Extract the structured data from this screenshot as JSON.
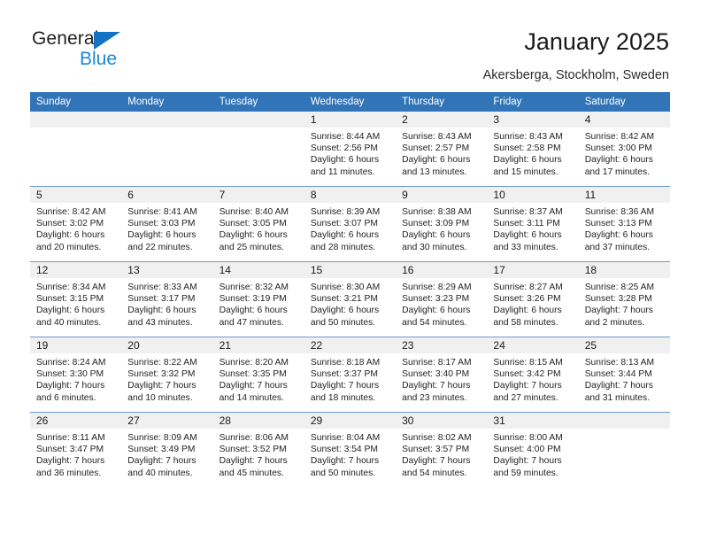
{
  "brand": {
    "name_part1": "General",
    "name_part2": "Blue",
    "triangle_icon": "blue-triangle-icon",
    "color_dark": "#231f20",
    "color_blue": "#1a87d8"
  },
  "header": {
    "title": "January 2025",
    "location": "Akersberga, Stockholm, Sweden"
  },
  "calendar": {
    "accent_color": "#3274b8",
    "daynum_band_color": "#f0f0f0",
    "weekday_headers": [
      "Sunday",
      "Monday",
      "Tuesday",
      "Wednesday",
      "Thursday",
      "Friday",
      "Saturday"
    ],
    "weeks": [
      [
        {
          "day": "",
          "blank": true
        },
        {
          "day": "",
          "blank": true
        },
        {
          "day": "",
          "blank": true
        },
        {
          "day": "1",
          "sunrise": "Sunrise: 8:44 AM",
          "sunset": "Sunset: 2:56 PM",
          "daylight_line1": "Daylight: 6 hours",
          "daylight_line2": "and 11 minutes."
        },
        {
          "day": "2",
          "sunrise": "Sunrise: 8:43 AM",
          "sunset": "Sunset: 2:57 PM",
          "daylight_line1": "Daylight: 6 hours",
          "daylight_line2": "and 13 minutes."
        },
        {
          "day": "3",
          "sunrise": "Sunrise: 8:43 AM",
          "sunset": "Sunset: 2:58 PM",
          "daylight_line1": "Daylight: 6 hours",
          "daylight_line2": "and 15 minutes."
        },
        {
          "day": "4",
          "sunrise": "Sunrise: 8:42 AM",
          "sunset": "Sunset: 3:00 PM",
          "daylight_line1": "Daylight: 6 hours",
          "daylight_line2": "and 17 minutes."
        }
      ],
      [
        {
          "day": "5",
          "sunrise": "Sunrise: 8:42 AM",
          "sunset": "Sunset: 3:02 PM",
          "daylight_line1": "Daylight: 6 hours",
          "daylight_line2": "and 20 minutes."
        },
        {
          "day": "6",
          "sunrise": "Sunrise: 8:41 AM",
          "sunset": "Sunset: 3:03 PM",
          "daylight_line1": "Daylight: 6 hours",
          "daylight_line2": "and 22 minutes."
        },
        {
          "day": "7",
          "sunrise": "Sunrise: 8:40 AM",
          "sunset": "Sunset: 3:05 PM",
          "daylight_line1": "Daylight: 6 hours",
          "daylight_line2": "and 25 minutes."
        },
        {
          "day": "8",
          "sunrise": "Sunrise: 8:39 AM",
          "sunset": "Sunset: 3:07 PM",
          "daylight_line1": "Daylight: 6 hours",
          "daylight_line2": "and 28 minutes."
        },
        {
          "day": "9",
          "sunrise": "Sunrise: 8:38 AM",
          "sunset": "Sunset: 3:09 PM",
          "daylight_line1": "Daylight: 6 hours",
          "daylight_line2": "and 30 minutes."
        },
        {
          "day": "10",
          "sunrise": "Sunrise: 8:37 AM",
          "sunset": "Sunset: 3:11 PM",
          "daylight_line1": "Daylight: 6 hours",
          "daylight_line2": "and 33 minutes."
        },
        {
          "day": "11",
          "sunrise": "Sunrise: 8:36 AM",
          "sunset": "Sunset: 3:13 PM",
          "daylight_line1": "Daylight: 6 hours",
          "daylight_line2": "and 37 minutes."
        }
      ],
      [
        {
          "day": "12",
          "sunrise": "Sunrise: 8:34 AM",
          "sunset": "Sunset: 3:15 PM",
          "daylight_line1": "Daylight: 6 hours",
          "daylight_line2": "and 40 minutes."
        },
        {
          "day": "13",
          "sunrise": "Sunrise: 8:33 AM",
          "sunset": "Sunset: 3:17 PM",
          "daylight_line1": "Daylight: 6 hours",
          "daylight_line2": "and 43 minutes."
        },
        {
          "day": "14",
          "sunrise": "Sunrise: 8:32 AM",
          "sunset": "Sunset: 3:19 PM",
          "daylight_line1": "Daylight: 6 hours",
          "daylight_line2": "and 47 minutes."
        },
        {
          "day": "15",
          "sunrise": "Sunrise: 8:30 AM",
          "sunset": "Sunset: 3:21 PM",
          "daylight_line1": "Daylight: 6 hours",
          "daylight_line2": "and 50 minutes."
        },
        {
          "day": "16",
          "sunrise": "Sunrise: 8:29 AM",
          "sunset": "Sunset: 3:23 PM",
          "daylight_line1": "Daylight: 6 hours",
          "daylight_line2": "and 54 minutes."
        },
        {
          "day": "17",
          "sunrise": "Sunrise: 8:27 AM",
          "sunset": "Sunset: 3:26 PM",
          "daylight_line1": "Daylight: 6 hours",
          "daylight_line2": "and 58 minutes."
        },
        {
          "day": "18",
          "sunrise": "Sunrise: 8:25 AM",
          "sunset": "Sunset: 3:28 PM",
          "daylight_line1": "Daylight: 7 hours",
          "daylight_line2": "and 2 minutes."
        }
      ],
      [
        {
          "day": "19",
          "sunrise": "Sunrise: 8:24 AM",
          "sunset": "Sunset: 3:30 PM",
          "daylight_line1": "Daylight: 7 hours",
          "daylight_line2": "and 6 minutes."
        },
        {
          "day": "20",
          "sunrise": "Sunrise: 8:22 AM",
          "sunset": "Sunset: 3:32 PM",
          "daylight_line1": "Daylight: 7 hours",
          "daylight_line2": "and 10 minutes."
        },
        {
          "day": "21",
          "sunrise": "Sunrise: 8:20 AM",
          "sunset": "Sunset: 3:35 PM",
          "daylight_line1": "Daylight: 7 hours",
          "daylight_line2": "and 14 minutes."
        },
        {
          "day": "22",
          "sunrise": "Sunrise: 8:18 AM",
          "sunset": "Sunset: 3:37 PM",
          "daylight_line1": "Daylight: 7 hours",
          "daylight_line2": "and 18 minutes."
        },
        {
          "day": "23",
          "sunrise": "Sunrise: 8:17 AM",
          "sunset": "Sunset: 3:40 PM",
          "daylight_line1": "Daylight: 7 hours",
          "daylight_line2": "and 23 minutes."
        },
        {
          "day": "24",
          "sunrise": "Sunrise: 8:15 AM",
          "sunset": "Sunset: 3:42 PM",
          "daylight_line1": "Daylight: 7 hours",
          "daylight_line2": "and 27 minutes."
        },
        {
          "day": "25",
          "sunrise": "Sunrise: 8:13 AM",
          "sunset": "Sunset: 3:44 PM",
          "daylight_line1": "Daylight: 7 hours",
          "daylight_line2": "and 31 minutes."
        }
      ],
      [
        {
          "day": "26",
          "sunrise": "Sunrise: 8:11 AM",
          "sunset": "Sunset: 3:47 PM",
          "daylight_line1": "Daylight: 7 hours",
          "daylight_line2": "and 36 minutes."
        },
        {
          "day": "27",
          "sunrise": "Sunrise: 8:09 AM",
          "sunset": "Sunset: 3:49 PM",
          "daylight_line1": "Daylight: 7 hours",
          "daylight_line2": "and 40 minutes."
        },
        {
          "day": "28",
          "sunrise": "Sunrise: 8:06 AM",
          "sunset": "Sunset: 3:52 PM",
          "daylight_line1": "Daylight: 7 hours",
          "daylight_line2": "and 45 minutes."
        },
        {
          "day": "29",
          "sunrise": "Sunrise: 8:04 AM",
          "sunset": "Sunset: 3:54 PM",
          "daylight_line1": "Daylight: 7 hours",
          "daylight_line2": "and 50 minutes."
        },
        {
          "day": "30",
          "sunrise": "Sunrise: 8:02 AM",
          "sunset": "Sunset: 3:57 PM",
          "daylight_line1": "Daylight: 7 hours",
          "daylight_line2": "and 54 minutes."
        },
        {
          "day": "31",
          "sunrise": "Sunrise: 8:00 AM",
          "sunset": "Sunset: 4:00 PM",
          "daylight_line1": "Daylight: 7 hours",
          "daylight_line2": "and 59 minutes."
        },
        {
          "day": "",
          "blank": true
        }
      ]
    ]
  }
}
